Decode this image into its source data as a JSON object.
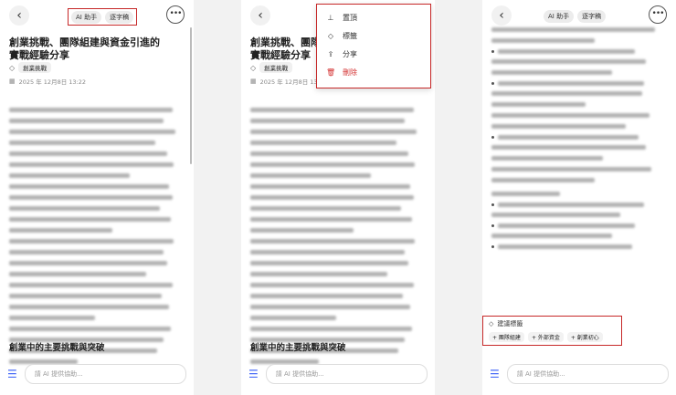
{
  "header": {
    "back_glyph": "‹",
    "more_glyph": "•••",
    "segments": [
      "AI 助手",
      "逐字稿"
    ]
  },
  "note": {
    "title": "創業挑戰、團隊組建與資金引進的實戰經驗分享",
    "tag": "創業挑戰",
    "date": "2025 年 12月8日 13:22",
    "section_title": "創業中的主要挑戰與突破"
  },
  "menu": {
    "items": [
      {
        "label": "置頂",
        "icon": "pin-icon"
      },
      {
        "label": "標籤",
        "icon": "tag-icon"
      },
      {
        "label": "分享",
        "icon": "share-icon"
      },
      {
        "label": "刪除",
        "icon": "trash-icon"
      }
    ]
  },
  "suggest": {
    "title": "建議標籤",
    "tags": [
      "+ 團隊組建",
      "+ 外部資金",
      "+ 創業初心"
    ]
  },
  "input": {
    "placeholder": "請 AI 提供協助..."
  },
  "colors": {
    "highlight": "#c62828",
    "accent": "#4a6cf7",
    "danger": "#d32f2f"
  }
}
